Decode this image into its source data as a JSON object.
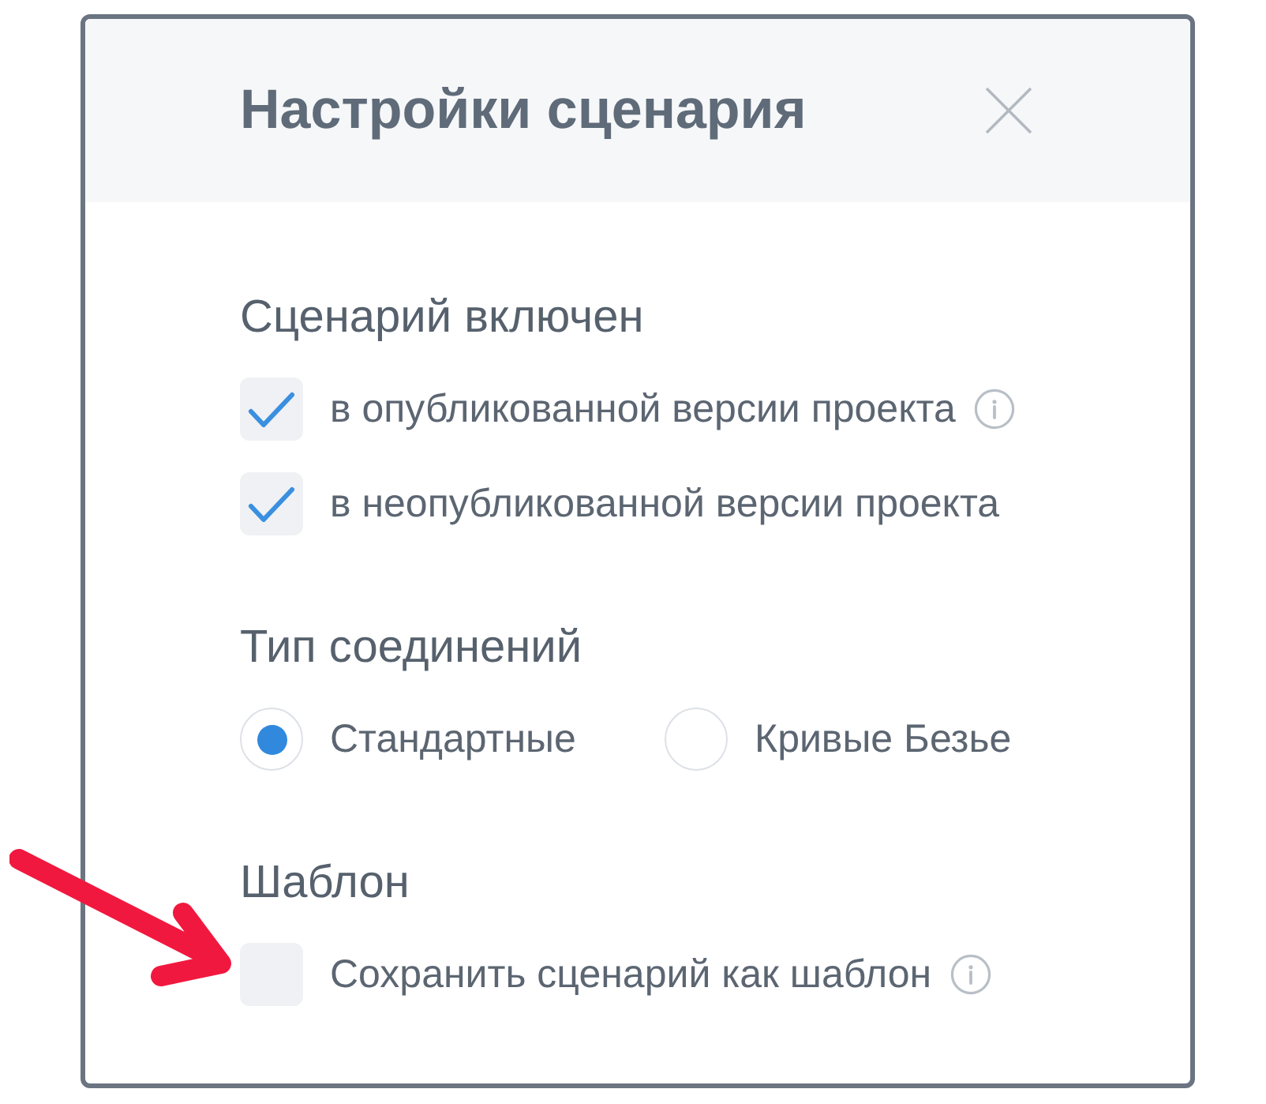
{
  "dialog": {
    "title": "Настройки сценария"
  },
  "sections": [
    {
      "heading": "Сценарий включен",
      "kind": "checkboxes",
      "items": [
        {
          "label": "в опубликованной версии проекта",
          "checked": true,
          "info": true
        },
        {
          "label": "в неопубликованной версии проекта",
          "checked": true,
          "info": false
        }
      ]
    },
    {
      "heading": "Тип соединений",
      "kind": "radios",
      "options": [
        {
          "label": "Стандартные",
          "selected": true
        },
        {
          "label": "Кривые Безье",
          "selected": false
        }
      ]
    },
    {
      "heading": "Шаблон",
      "kind": "checkboxes",
      "items": [
        {
          "label": "Сохранить сценарий как шаблон",
          "checked": false,
          "info": true
        }
      ]
    }
  ]
}
